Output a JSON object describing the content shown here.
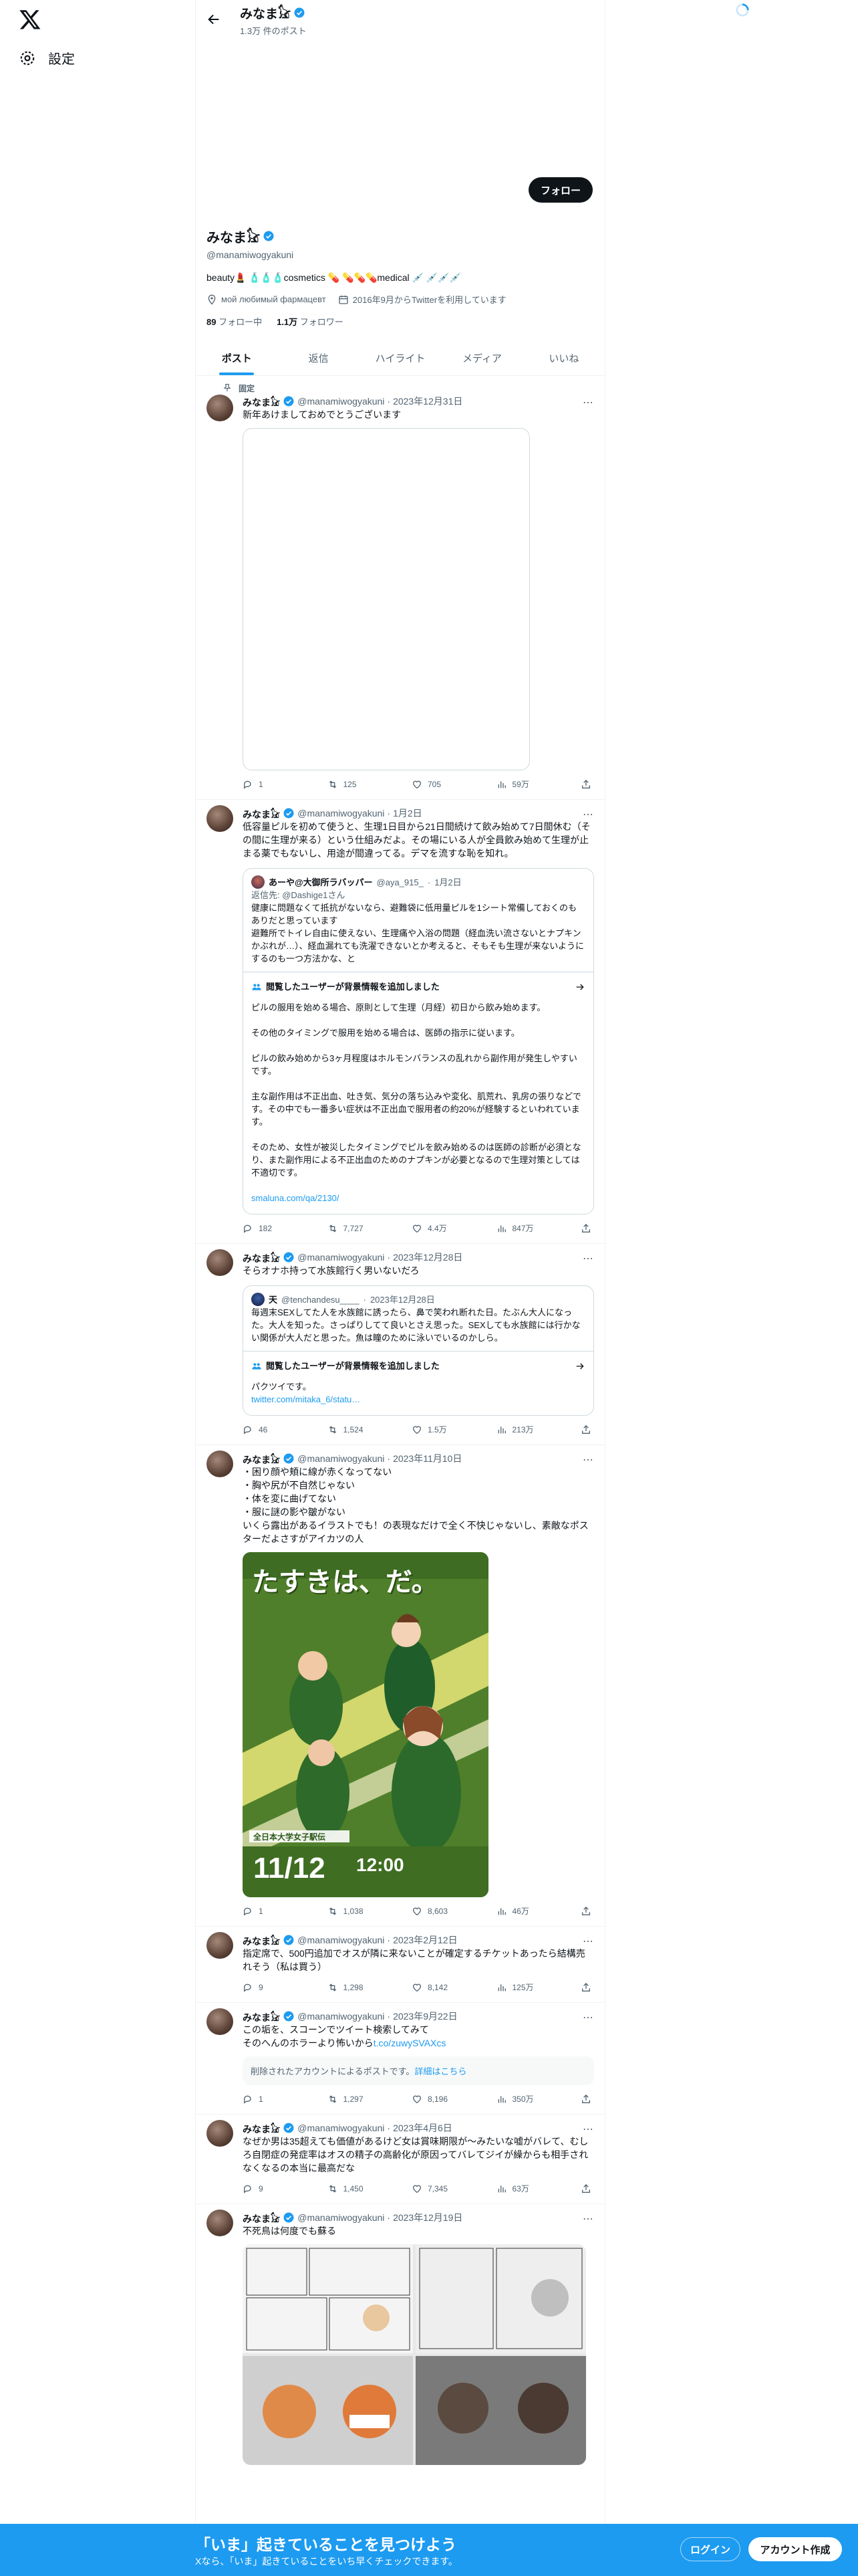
{
  "nav": {
    "settings_label": "設定"
  },
  "header": {
    "name": "みなま𓃠",
    "post_count": "1.3万 件のポスト"
  },
  "profile": {
    "name": "みなま𓃠",
    "handle": "@manamiwogyakuni",
    "bio": "beauty💄 🧴🧴🧴cosmetics 💊 💊💊💊medical 💉 💉💉💉",
    "location": "мой любимый фармацевт",
    "joined": "2016年9月からTwitterを利用しています",
    "following_count": "89",
    "following_label": " フォロー中",
    "followers_count": "1.1万",
    "followers_label": " フォロワー",
    "follow_button": "フォロー"
  },
  "tabs": [
    "ポスト",
    "返信",
    "ハイライト",
    "メディア",
    "いいね"
  ],
  "pinned_label": "固定",
  "tweets": [
    {
      "name": "みなま𓃠",
      "handle": "@manamiwogyakuni",
      "date": "2023年12月31日",
      "text": "新年あけましておめでとうございます",
      "replies": "1",
      "retweets": "125",
      "likes": "705",
      "views": "59万"
    },
    {
      "name": "みなま𓃠",
      "handle": "@manamiwogyakuni",
      "date": "1月2日",
      "text": "低容量ピルを初めて使うと、生理1日目から21日間続けて飲み始めて7日間休む（その間に生理が来る）という仕組みだよ。その場にいる人が全員飲み始めて生理が止まる薬でもないし、用途が間違ってる。デマを流すな恥を知れ。",
      "quote": {
        "name": "あーや@大御所ラバッパー",
        "handle": "@aya_915_",
        "date": "1月2日",
        "reply_to": "返信先: @Dashige1さん",
        "text": "健康に問題なくて抵抗がないなら、避難袋に低用量ピルを1シート常備しておくのもありだと思っています\n避難所でトイレ自由に使えない、生理痛や入浴の問題（経血洗い流さないとナプキンかぶれが…）、経血漏れても洗濯できないとか考えると、そもそも生理が来ないようにするのも一つ方法かな、と"
      },
      "context": {
        "title": "閲覧したユーザーが背景情報を追加しました",
        "paragraphs": [
          "ピルの服用を始める場合、原則として生理（月経）初日から飲み始めます。",
          "その他のタイミングで服用を始める場合は、医師の指示に従います。",
          "ピルの飲み始めから3ヶ月程度はホルモンバランスの乱れから副作用が発生しやすいです。",
          "主な副作用は不正出血、吐き気、気分の落ち込みや変化、肌荒れ、乳房の張りなどです。その中でも一番多い症状は不正出血で服用者の約20%が経験するといわれています。",
          "そのため、女性が被災したタイミングでピルを飲み始めるのは医師の診断が必須となり、また副作用による不正出血のためのナプキンが必要となるので生理対策としては不適切です。"
        ],
        "link": "smaluna.com/qa/2130/"
      },
      "replies": "182",
      "retweets": "7,727",
      "likes": "4.4万",
      "views": "847万"
    },
    {
      "name": "みなま𓃠",
      "handle": "@manamiwogyakuni",
      "date": "2023年12月28日",
      "text": "そらオナホ持って水族館行く男いないだろ",
      "quote": {
        "name": "天",
        "handle": "@tenchandesu____",
        "date": "2023年12月28日",
        "text": "毎週末SEXしてた人を水族館に誘ったら、鼻で笑われ断れた日。たぶん大人になった。大人を知った。さっぱりしてて良いとさえ思った。SEXしても水族館には行かない関係が大人だと思った。魚は瞳のために泳いでいるのかしら。"
      },
      "context": {
        "title": "閲覧したユーザーが背景情報を追加しました",
        "paragraphs": [
          "パクツイです。"
        ],
        "link": "twitter.com/mitaka_6/statu…"
      },
      "replies": "46",
      "retweets": "1,524",
      "likes": "1.5万",
      "views": "213万"
    },
    {
      "name": "みなま𓃠",
      "handle": "@manamiwogyakuni",
      "date": "2023年11月10日",
      "text": "・困り顔や頬に線が赤くなってない\n・胸や尻が不自然じゃない\n・体を変に曲げてない\n・服に謎の影や皺がない\nいくら露出があるイラストでも！の表現なだけで全く不快じゃないし、素敵なポスターだよさすがアイカツの人",
      "poster": {
        "headline": "たすきは、だ。",
        "date": "11/12",
        "time": "12:00",
        "subtitle": "全日本大学女子駅伝"
      },
      "replies": "1",
      "retweets": "1,038",
      "likes": "8,603",
      "views": "46万"
    },
    {
      "name": "みなま𓃠",
      "handle": "@manamiwogyakuni",
      "date": "2023年2月12日",
      "text": "指定席で、500円追加でオスが隣に来ないことが確定するチケットあったら結構売れそう（私は買う）",
      "replies": "9",
      "retweets": "1,298",
      "likes": "8,142",
      "views": "125万"
    },
    {
      "name": "みなま𓃠",
      "handle": "@manamiwogyakuni",
      "date": "2023年9月22日",
      "text": "この垢を、スコーンでツイート検索してみて\nそのへんのホラーより怖いから",
      "text_link": "t.co/zuwySVAXcs",
      "deleted": "削除されたアカウントによるポストです。",
      "deleted_link": "詳細はこちら",
      "replies": "1",
      "retweets": "1,297",
      "likes": "8,196",
      "views": "350万"
    },
    {
      "name": "みなま𓃠",
      "handle": "@manamiwogyakuni",
      "date": "2023年4月6日",
      "text": "なぜか男は35超えても価値があるけど女は賞味期限が〜みたいな嘘がバレて、むしろ自閉症の発症率はオスの精子の高齢化が原因ってバレてジイが繰からも相手されなくなるの本当に最高だな",
      "replies": "9",
      "retweets": "1,450",
      "likes": "7,345",
      "views": "63万"
    },
    {
      "name": "みなま𓃠",
      "handle": "@manamiwogyakuni",
      "date": "2023年12月19日",
      "text": "不死鳥は何度でも蘇る"
    }
  ],
  "bottom_bar": {
    "title": "「いま」起きていることを見つけよう",
    "subtitle": "Xなら、「いま」起きていることをいち早くチェックできます。",
    "login": "ログイン",
    "signup": "アカウント作成"
  },
  "colors": {
    "accent": "#1d9bf0",
    "text": "#0f1419",
    "muted": "#536471"
  }
}
